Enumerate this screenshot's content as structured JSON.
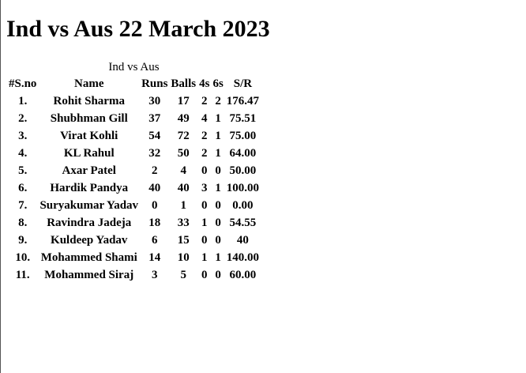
{
  "page": {
    "title": "Ind vs Aus 22 March 2023"
  },
  "table": {
    "caption": "Ind vs Aus",
    "headers": [
      "#S.no",
      "Name",
      "Runs",
      "Balls",
      "4s",
      "6s",
      "S/R"
    ],
    "rows": [
      [
        "1.",
        "Rohit Sharma",
        "30",
        "17",
        "2",
        "2",
        "176.47"
      ],
      [
        "2.",
        "Shubhman Gill",
        "37",
        "49",
        "4",
        "1",
        "75.51"
      ],
      [
        "3.",
        "Virat Kohli",
        "54",
        "72",
        "2",
        "1",
        "75.00"
      ],
      [
        "4.",
        "KL Rahul",
        "32",
        "50",
        "2",
        "1",
        "64.00"
      ],
      [
        "5.",
        "Axar Patel",
        "2",
        "4",
        "0",
        "0",
        "50.00"
      ],
      [
        "6.",
        "Hardik Pandya",
        "40",
        "40",
        "3",
        "1",
        "100.00"
      ],
      [
        "7.",
        "Suryakumar Yadav",
        "0",
        "1",
        "0",
        "0",
        "0.00"
      ],
      [
        "8.",
        "Ravindra Jadeja",
        "18",
        "33",
        "1",
        "0",
        "54.55"
      ],
      [
        "9.",
        "Kuldeep Yadav",
        "6",
        "15",
        "0",
        "0",
        "40"
      ],
      [
        "10.",
        "Mohammed Shami",
        "14",
        "10",
        "1",
        "1",
        "140.00"
      ],
      [
        "11.",
        "Mohammed Siraj",
        "3",
        "5",
        "0",
        "0",
        "60.00"
      ]
    ]
  }
}
